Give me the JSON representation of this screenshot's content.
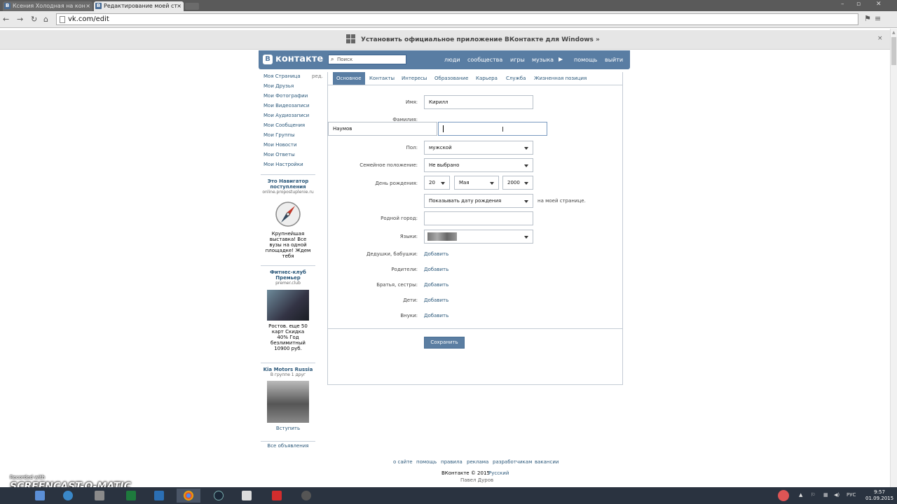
{
  "browser": {
    "tabs": [
      {
        "label": "Ксения Холодная на кон",
        "favicon": "B"
      },
      {
        "label": "Редактирование моей ст",
        "favicon": "B"
      }
    ],
    "url": "vk.com/edit"
  },
  "promo_bar": {
    "text": "Установить официальное приложение ВКонтакте для Windows »",
    "close": "×"
  },
  "header": {
    "logo_letter": "В",
    "logo_text": "контакте",
    "search_placeholder": "Поиск",
    "nav": [
      "люди",
      "сообщества",
      "игры",
      "музыка",
      "помощь",
      "выйти"
    ],
    "play_icon": "▶"
  },
  "left_menu": {
    "edit_label": "ред.",
    "items": [
      "Моя Страница",
      "Мои Друзья",
      "Мои Фотографии",
      "Мои Видеозаписи",
      "Мои Аудиозаписи",
      "Мои Сообщения",
      "Мои Группы",
      "Мои Новости",
      "Мои Ответы",
      "Мои Настройки"
    ]
  },
  "ads": [
    {
      "title": "Это Навигатор поступления",
      "subtitle": "online.propostuplenie.ru",
      "text": "Крупнейшая выставка! Все вузы на одной площадке! Ждем тебя"
    },
    {
      "title": "Фитнес-клуб Премьер",
      "subtitle": "premer.club",
      "text": "Ростов. еще 50 карт Скидка 40% Год безлимитный 10900 руб."
    },
    {
      "title": "Kia Motors Russia",
      "subtitle": "В группе 1 друг",
      "text": "Вступить"
    }
  ],
  "ads_all": "Все объявления",
  "edit": {
    "tabs": [
      "Основное",
      "Контакты",
      "Интересы",
      "Образование",
      "Карьера",
      "Служба",
      "Жизненная позиция"
    ],
    "labels": {
      "first_name": "Имя:",
      "last_name": "Фамилия:",
      "sex": "Пол:",
      "marital": "Семейное положение:",
      "birthday": "День рождения:",
      "hometown": "Родной город:",
      "languages": "Языки:",
      "grandparents": "Дедушки, бабушки:",
      "parents": "Родители:",
      "siblings": "Братья, сестры:",
      "children": "Дети:",
      "grandchildren": "Внуки:"
    },
    "values": {
      "first_name": "Кирилл",
      "last_name": "Наумов",
      "sex": "мужской",
      "marital": "Не выбрано",
      "bday_day": "20",
      "bday_month": "Мая",
      "bday_year": "2000",
      "bday_show": "Показывать дату рождения",
      "bday_show_suffix": "на моей странице.",
      "hometown": ""
    },
    "add_label": "Добавить",
    "save_label": "Сохранить"
  },
  "footer": {
    "links": [
      "о сайте",
      "помощь",
      "правила",
      "реклама",
      "разработчикам",
      "вакансии"
    ],
    "copyright": "ВКонтакте © 2015",
    "language": "Русский",
    "author": "Павел Дуров"
  },
  "watermark": {
    "line1": "Recorded with",
    "line2": "SCREENCAST-O-MATIC"
  },
  "taskbar": {
    "lang": "РУС",
    "time": "9:57",
    "date": "01.09.2015"
  },
  "colors": {
    "vk_blue": "#597da3",
    "link": "#2b587a",
    "taskbar": "#2a3340"
  }
}
